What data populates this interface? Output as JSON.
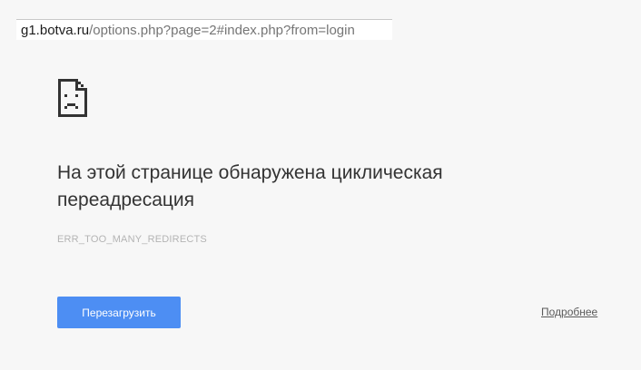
{
  "address_bar": {
    "host": "g1.botva.ru",
    "path": "/options.php?page=2#index.php?from=login"
  },
  "error": {
    "icon": "sad-page-icon",
    "title": "На этой странице обнаружена циклическая переадресация",
    "code": "ERR_TOO_MANY_REDIRECTS"
  },
  "actions": {
    "reload_label": "Перезагрузить",
    "details_label": "Подробнее"
  },
  "colors": {
    "background": "#f7f7f7",
    "button": "#4d8ef3",
    "title_text": "#333333",
    "code_text": "#b4b4b4"
  }
}
